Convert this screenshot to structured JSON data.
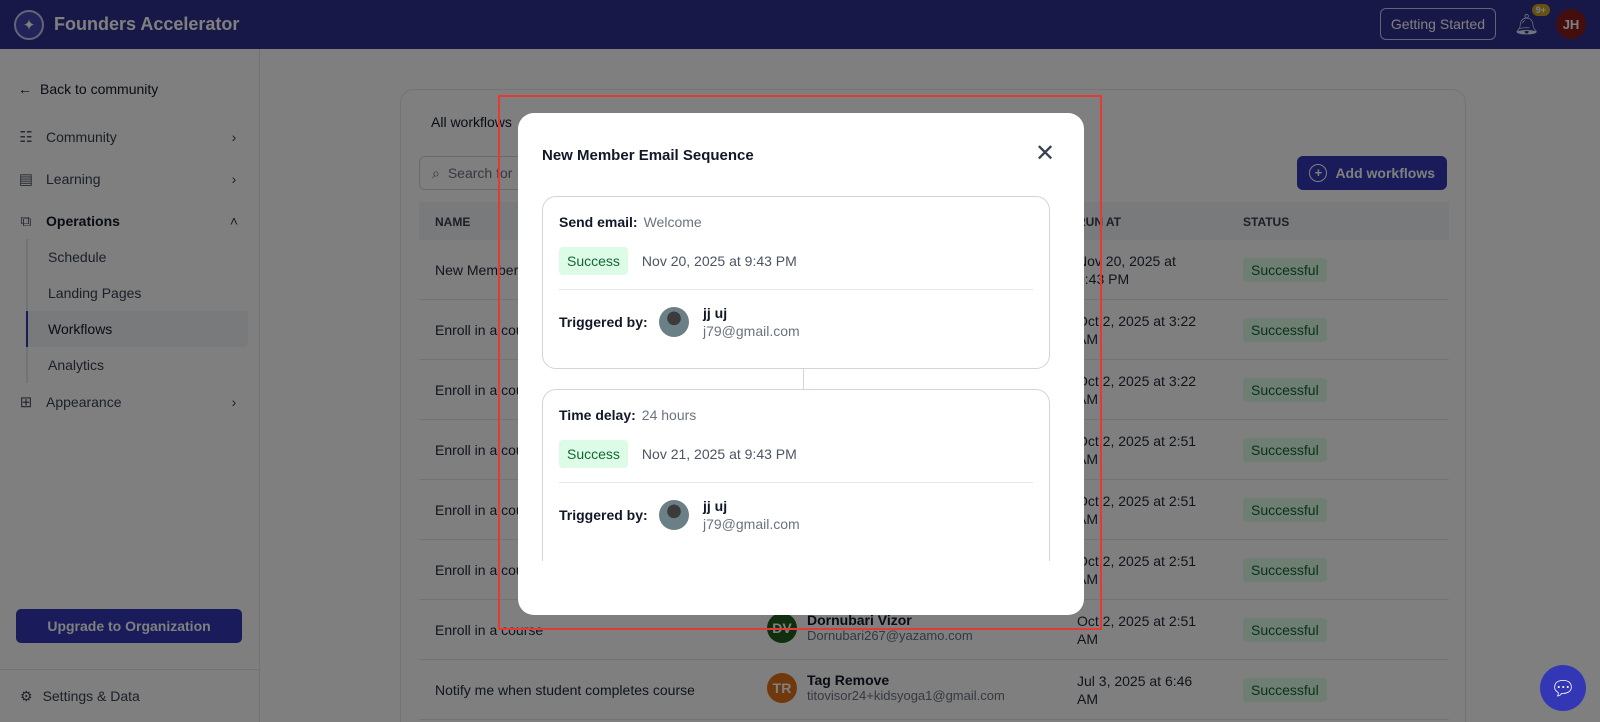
{
  "topbar": {
    "brand": "Founders Accelerator",
    "getting_started": "Getting Started",
    "notif_badge": "9+",
    "user_initials": "JH"
  },
  "sidebar": {
    "back": "Back to community",
    "items": [
      {
        "label": "Community",
        "icon": "community-icon"
      },
      {
        "label": "Learning",
        "icon": "book-icon"
      },
      {
        "label": "Operations",
        "icon": "operations-icon"
      },
      {
        "label": "Appearance",
        "icon": "appearance-icon"
      }
    ],
    "sub_items": [
      "Schedule",
      "Landing Pages",
      "Workflows",
      "Analytics"
    ],
    "upgrade": "Upgrade to Organization",
    "settings": "Settings & Data"
  },
  "main": {
    "tab": "All workflows",
    "search_placeholder": "Search for",
    "add_button": "Add workflows",
    "columns": {
      "name": "NAME",
      "run_at": "RUN AT",
      "status": "STATUS"
    },
    "rows": [
      {
        "name": "New Member",
        "user_initials": "",
        "user_name": "",
        "user_email": "",
        "user_color": "",
        "run_at": "Nov 20, 2025 at 9:43 PM",
        "status": "Successful"
      },
      {
        "name": "Enroll in a cou",
        "user_initials": "",
        "user_name": "",
        "user_email": "",
        "user_color": "",
        "run_at": "Oct 2, 2025 at 3:22 AM",
        "status": "Successful"
      },
      {
        "name": "Enroll in a cou",
        "user_initials": "",
        "user_name": "",
        "user_email": "",
        "user_color": "",
        "run_at": "Oct 2, 2025 at 3:22 AM",
        "status": "Successful"
      },
      {
        "name": "Enroll in a cou",
        "user_initials": "",
        "user_name": "",
        "user_email": "",
        "user_color": "",
        "run_at": "Oct 2, 2025 at 2:51 AM",
        "status": "Successful"
      },
      {
        "name": "Enroll in a cou",
        "user_initials": "",
        "user_name": "",
        "user_email": "",
        "user_color": "",
        "run_at": "Oct 2, 2025 at 2:51 AM",
        "status": "Successful"
      },
      {
        "name": "Enroll in a cou",
        "user_initials": "",
        "user_name": "",
        "user_email": "",
        "user_color": "",
        "run_at": "Oct 2, 2025 at 2:51 AM",
        "status": "Successful"
      },
      {
        "name": "Enroll in a course",
        "user_initials": "DV",
        "user_name": "Dornubari Vizor",
        "user_email": "Dornubari267@yazamo.com",
        "user_color": "#1f5f1f",
        "run_at": "Oct 2, 2025 at 2:51 AM",
        "status": "Successful"
      },
      {
        "name": "Notify me when student completes course",
        "user_initials": "TR",
        "user_name": "Tag Remove",
        "user_email": "titovisor24+kidsyoga1@gmail.com",
        "user_color": "#e0701a",
        "run_at": "Jul 3, 2025 at 6:46 AM",
        "status": "Successful"
      }
    ]
  },
  "modal": {
    "title": "New Member Email Sequence",
    "steps": [
      {
        "key": "Send email:",
        "value": "Welcome",
        "status": "Success",
        "date": "Nov 20, 2025 at 9:43 PM",
        "triggered_label": "Triggered by:",
        "user_name": "jj uj",
        "user_email": "j79@gmail.com"
      },
      {
        "key": "Time delay:",
        "value": "24 hours",
        "status": "Success",
        "date": "Nov 21, 2025 at 9:43 PM",
        "triggered_label": "Triggered by:",
        "user_name": "jj uj",
        "user_email": "j79@gmail.com"
      }
    ]
  },
  "colors": {
    "brand": "#2f3190",
    "accent": "#3337b5",
    "success_bg": "#dcfce7",
    "success_text": "#166534"
  }
}
